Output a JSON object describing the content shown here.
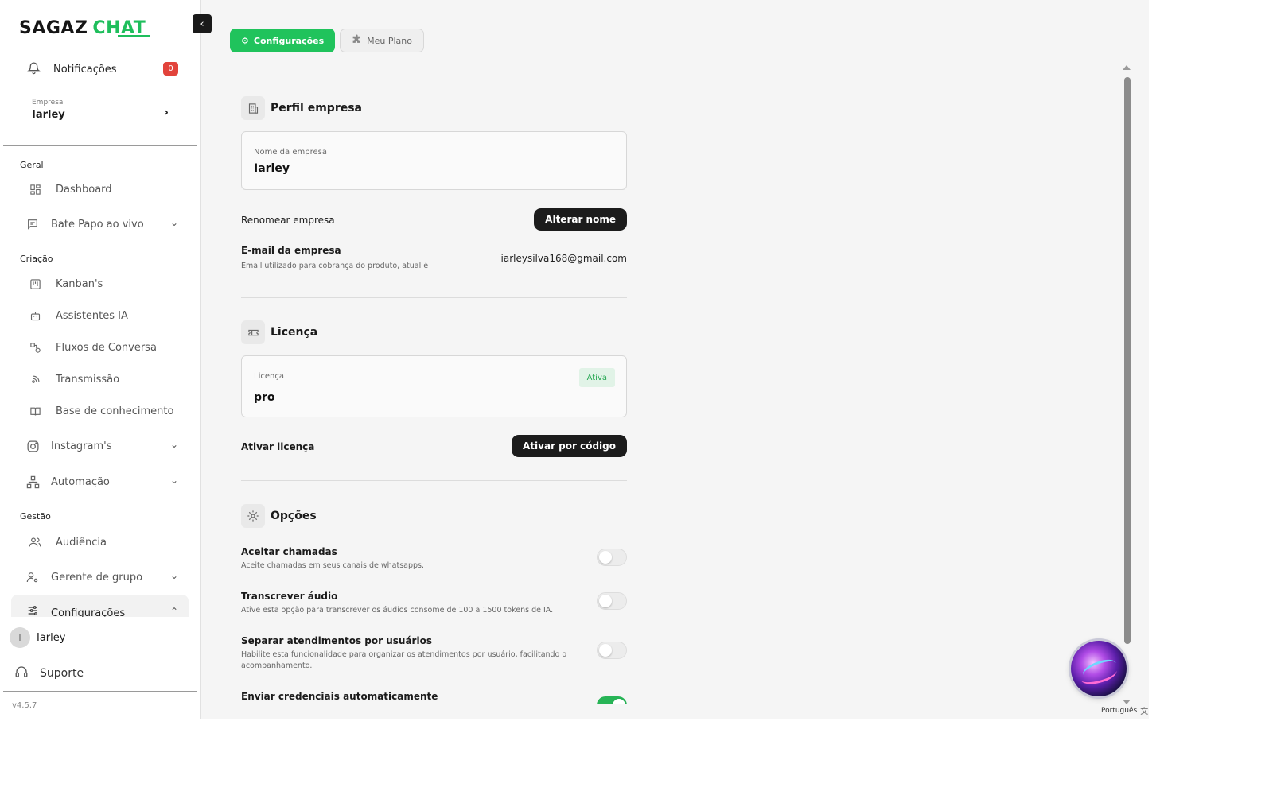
{
  "app": {
    "logo_part1": "SAGAZ",
    "logo_part2": "CHAT",
    "brand_color": "#20c35c"
  },
  "sidebar": {
    "notifications": {
      "label": "Notificações",
      "count": "0"
    },
    "company": {
      "caption": "Empresa",
      "name": "Iarley"
    },
    "sections": {
      "geral": "Geral",
      "criacao": "Criação",
      "gestao": "Gestão"
    },
    "items": {
      "dashboard": "Dashboard",
      "bate_papo": "Bate Papo ao vivo",
      "kanbans": "Kanban's",
      "assistentes": "Assistentes IA",
      "fluxos": "Fluxos de Conversa",
      "transmissao": "Transmissão",
      "base": "Base de conhecimento",
      "instagram": "Instagram's",
      "automacao": "Automação",
      "audiencia": "Audiência",
      "gerente": "Gerente de grupo",
      "configuracoes": "Configurações"
    },
    "user": {
      "initial": "I",
      "name": "Iarley"
    },
    "support": "Suporte",
    "version": "v4.5.7"
  },
  "tabs": [
    {
      "label": "Configurações",
      "icon": "gear-icon",
      "active": true
    },
    {
      "label": "Meu Plano",
      "icon": "puzzle-icon",
      "active": false
    }
  ],
  "perfil": {
    "title": "Perfil empresa",
    "name_caption": "Nome da empresa",
    "name_value": "Iarley",
    "rename_label": "Renomear empresa",
    "rename_button": "Alterar nome",
    "email_label": "E-mail da empresa",
    "email_desc": "Email utilizado para cobrança do produto, atual é",
    "email_value": "iarleysilva168@gmail.com"
  },
  "licenca": {
    "title": "Licença",
    "caption": "Licença",
    "value": "pro",
    "status": "Ativa",
    "activate_label": "Ativar licença",
    "activate_button": "Ativar por código"
  },
  "opcoes": {
    "title": "Opções",
    "items": [
      {
        "label": "Aceitar chamadas",
        "desc": "Aceite chamadas em seus canais de whatsapps.",
        "enabled": false
      },
      {
        "label": "Transcrever áudio",
        "desc": "Ative esta opção para transcrever os áudios consome de 100 a 1500 tokens de IA.",
        "enabled": false
      },
      {
        "label": "Separar atendimentos por usuários",
        "desc": "Habilite esta funcionalidade para organizar os atendimentos por usuário, facilitando o acompanhamento.",
        "enabled": false
      },
      {
        "label": "Enviar credenciais automaticamente",
        "desc": "",
        "enabled": true
      }
    ]
  },
  "language": "Português"
}
